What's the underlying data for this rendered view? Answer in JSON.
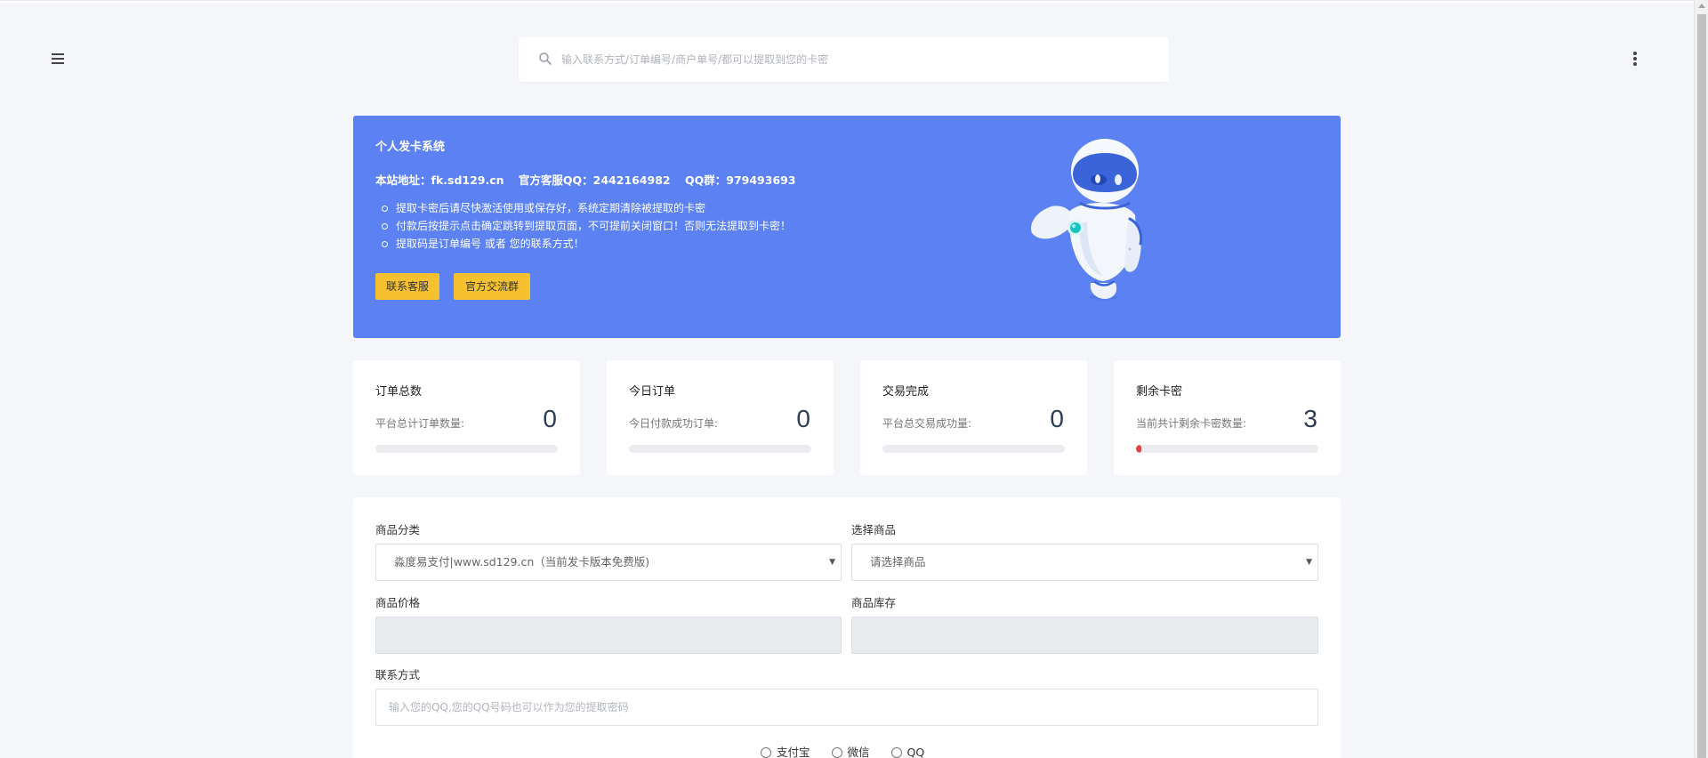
{
  "header": {
    "menu_icon": "hamburger-icon",
    "more_icon": "more-vertical-icon",
    "search": {
      "icon": "search-icon",
      "placeholder": "输入联系方式/订单编号/商户单号/都可以提取到您的卡密"
    }
  },
  "hero": {
    "title": "个人发卡系统",
    "site": "本站地址：fk.sd129.cn",
    "qq_service": "官方客服QQ：2442164982",
    "qq_group": "QQ群：979493693",
    "notes": [
      "提取卡密后请尽快激活使用或保存好，系统定期清除被提取的卡密",
      "付款后按提示点击确定跳转到提取页面，不可提前关闭窗口！否则无法提取到卡密！",
      "提取码是订单编号 或者 您的联系方式！"
    ],
    "contact_button": "联系客服",
    "group_button": "官方交流群",
    "illustration": "robot-waving-illustration",
    "color": "#5b81f2",
    "button_color": "#f5c12e"
  },
  "stats": [
    {
      "title": "订单总数",
      "subtitle": "平台总计订单数量:",
      "value": "0",
      "progress": 0
    },
    {
      "title": "今日订单",
      "subtitle": "今日付款成功订单:",
      "value": "0",
      "progress": 0
    },
    {
      "title": "交易完成",
      "subtitle": "平台总交易成功量:",
      "value": "0",
      "progress": 0
    },
    {
      "title": "剩余卡密",
      "subtitle": "当前共计剩余卡密数量:",
      "value": "3",
      "progress": 0.03
    }
  ],
  "form": {
    "category_label": "商品分类",
    "category_value": "淼度易支付|www.sd129.cn（当前发卡版本免费版)",
    "product_label": "选择商品",
    "product_value": "请选择商品",
    "price_label": "商品价格",
    "stock_label": "商品库存",
    "contact_label": "联系方式",
    "contact_placeholder": "输入您的QQ,您的QQ号码也可以作为您的提取密码",
    "payment_options": [
      "支付宝",
      "微信",
      "QQ"
    ]
  }
}
